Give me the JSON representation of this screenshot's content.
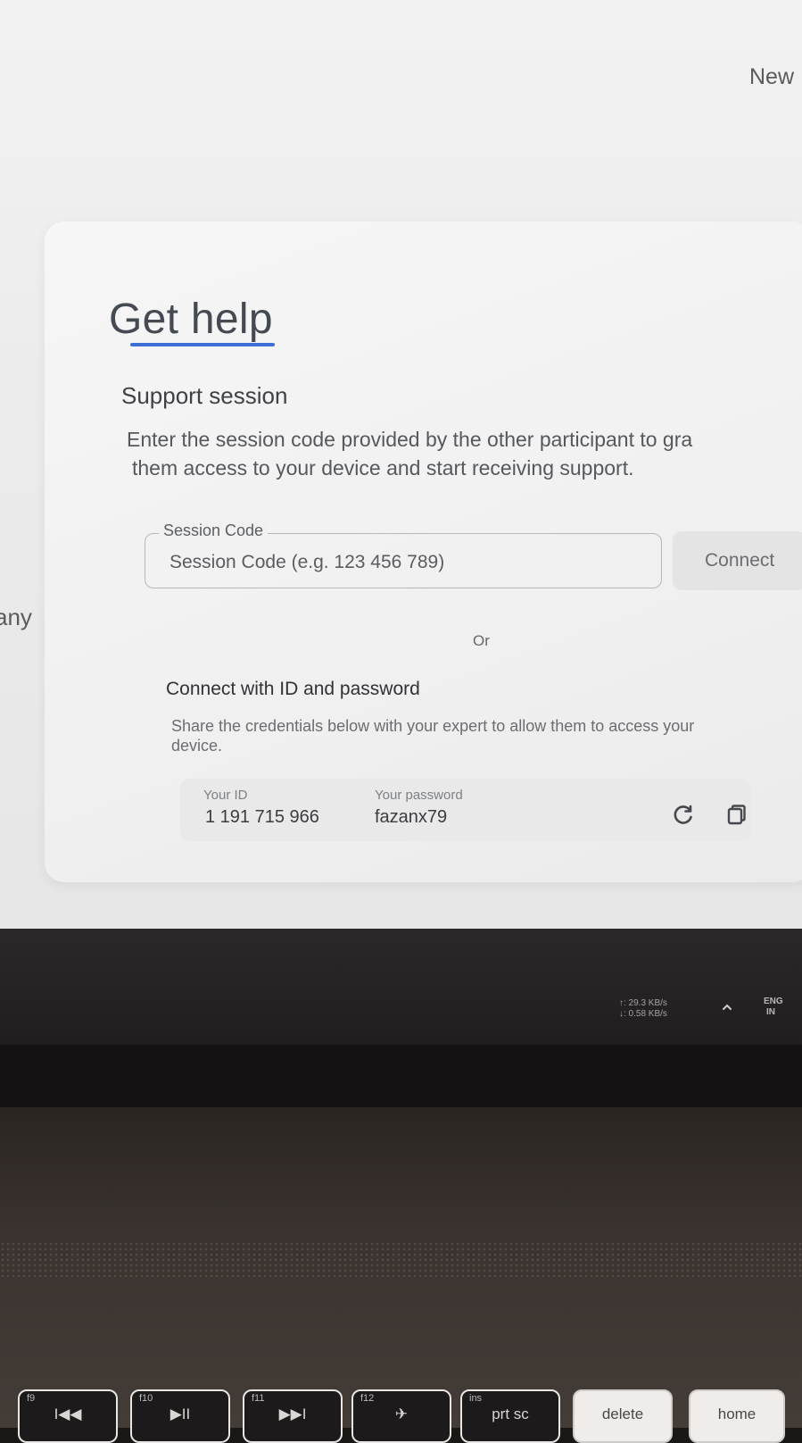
{
  "header": {
    "new_label": "New"
  },
  "side": {
    "partial_text": "any"
  },
  "get_help": {
    "title": "Get help",
    "support_session": {
      "heading": "Support session",
      "description_line1": "Enter the session code provided by the other participant to gra",
      "description_line2": "them access to your device and start receiving support.",
      "field_label": "Session Code",
      "field_placeholder": "Session Code (e.g. 123 456 789)",
      "connect_label": "Connect"
    },
    "or_label": "Or",
    "credentials": {
      "heading": "Connect with ID and password",
      "description": "Share the credentials below with your expert to allow them to access your device.",
      "id_label": "Your ID",
      "id_value": "1 191 715 966",
      "password_label": "Your password",
      "password_value": "fazanx79",
      "refresh_icon": "refresh-icon",
      "copy_icon": "copy-icon"
    }
  },
  "taskbar": {
    "upload_speed": "↑: 29.3 KB/s",
    "download_speed": "↓: 0.58 KB/s",
    "language_line1": "ENG",
    "language_line2": "IN"
  },
  "keyboard": {
    "keys": [
      {
        "fn": "f9",
        "label": "I◀◀"
      },
      {
        "fn": "f10",
        "label": "▶II"
      },
      {
        "fn": "f11",
        "label": "▶▶I"
      },
      {
        "fn": "f12",
        "label": "✈"
      },
      {
        "fn": "ins",
        "label": "prt sc"
      },
      {
        "fn": "",
        "label": "delete"
      },
      {
        "fn": "",
        "label": "home"
      }
    ]
  },
  "colors": {
    "accent_underline": "#3d6fd6",
    "card_background": "#f3f3f3",
    "taskbar": "#262425"
  }
}
